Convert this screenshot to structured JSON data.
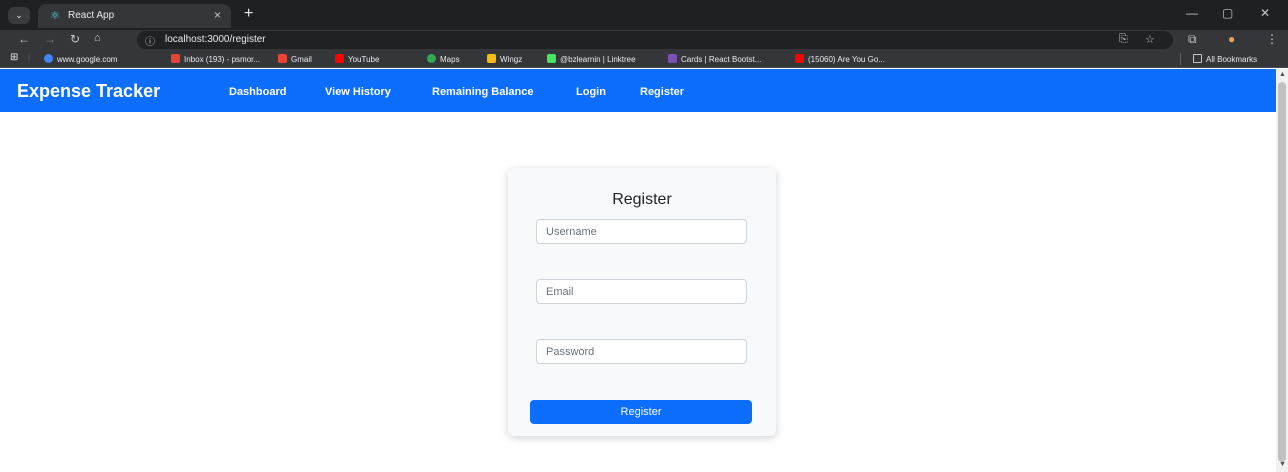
{
  "browser": {
    "tab_title": "React App",
    "tab_close": "×",
    "new_tab": "+",
    "url": "localhost:3000/register",
    "bookmarks": [
      {
        "label": "www.google.com",
        "color": "#4285f4"
      },
      {
        "label": "Inbox (193) - psmor...",
        "color": "#ea4335"
      },
      {
        "label": "Gmail",
        "color": "#ea4335"
      },
      {
        "label": "YouTube",
        "color": "#ff0000"
      },
      {
        "label": "Maps",
        "color": "#34a853"
      },
      {
        "label": "Wingz",
        "color": "#fbbc05"
      },
      {
        "label": "@bzlearnin | Linktree",
        "color": "#43e660"
      },
      {
        "label": "Cards | React Bootst...",
        "color": "#7952b3"
      },
      {
        "label": "(15060) Are You Go...",
        "color": "#ff0000"
      }
    ],
    "all_bookmarks": "All Bookmarks"
  },
  "navbar": {
    "brand": "Expense Tracker",
    "links": [
      "Dashboard",
      "View History",
      "Remaining Balance",
      "Login",
      "Register"
    ],
    "color": "#0d6efd"
  },
  "form": {
    "title": "Register",
    "username_placeholder": "Username",
    "email_placeholder": "Email",
    "password_placeholder": "Password",
    "submit_label": "Register"
  }
}
